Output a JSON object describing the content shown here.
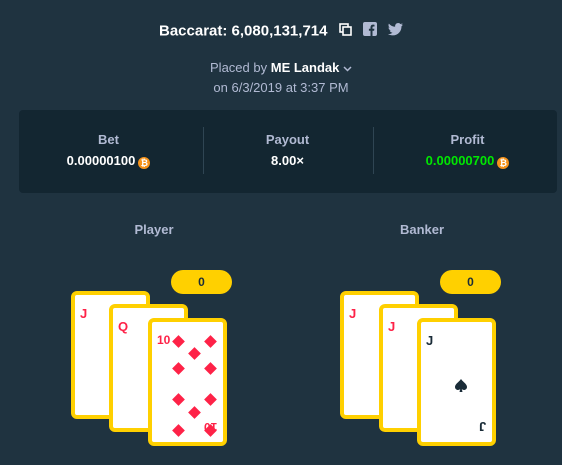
{
  "header": {
    "title": "Baccarat: 6,080,131,714",
    "placed_prefix": "Placed by",
    "placed_user": "ME Landak",
    "date": "on 6/3/2019 at 3:37 PM"
  },
  "stats": {
    "bet": {
      "label": "Bet",
      "value": "0.00000100"
    },
    "payout": {
      "label": "Payout",
      "value": "8.00×"
    },
    "profit": {
      "label": "Profit",
      "value": "0.00000700"
    }
  },
  "player": {
    "label": "Player",
    "score": "0",
    "cards": [
      {
        "rank": "J",
        "suit": "diamonds"
      },
      {
        "rank": "Q",
        "suit": "diamonds"
      },
      {
        "rank": "10",
        "suit": "diamonds"
      }
    ]
  },
  "banker": {
    "label": "Banker",
    "score": "0",
    "cards": [
      {
        "rank": "J",
        "suit": "diamonds"
      },
      {
        "rank": "J",
        "suit": "diamonds"
      },
      {
        "rank": "J",
        "suit": "spades"
      }
    ]
  },
  "colors": {
    "background": "#1f3340",
    "panel": "#132631",
    "accent": "#ffd000",
    "profit": "#00e701",
    "red_suit": "#fe2247",
    "coin": "#f7931a"
  },
  "icons": {
    "copy": "copy-icon",
    "facebook": "facebook-icon",
    "twitter": "twitter-icon",
    "chevron": "chevron-down-icon",
    "coin": "bitcoin-icon"
  }
}
